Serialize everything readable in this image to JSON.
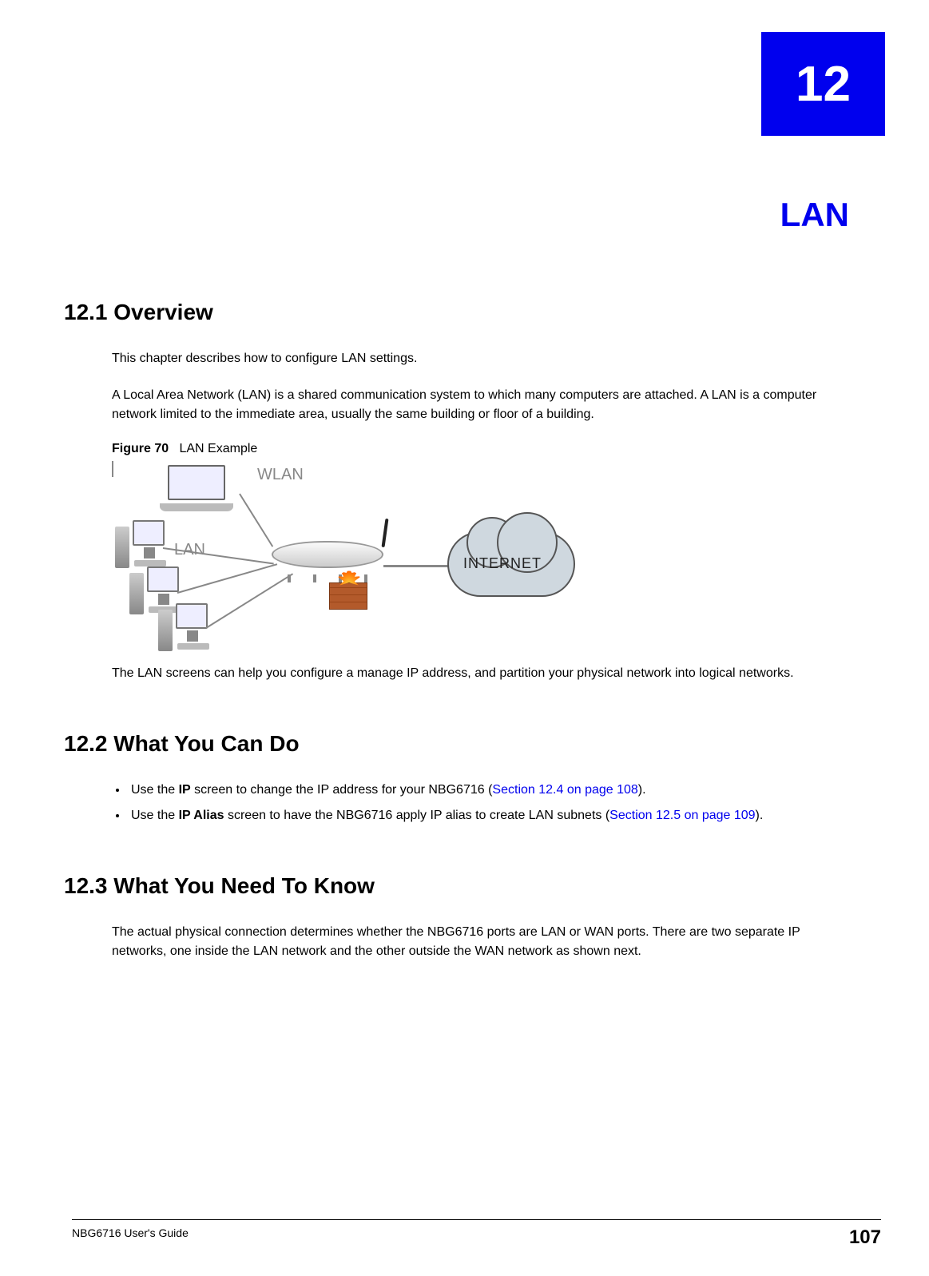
{
  "chapter": {
    "number": "12",
    "title": "LAN"
  },
  "sections": {
    "s1": {
      "heading": "12.1  Overview",
      "p1": "This chapter describes how to configure LAN settings.",
      "p2": "A Local Area Network (LAN) is a shared communication system to which many computers are attached. A LAN is a computer network limited to the immediate area, usually the same building or floor of a building.",
      "figure_label": "Figure 70",
      "figure_caption": "LAN Example",
      "diagram": {
        "wlan_label": "WLAN",
        "lan_label": "LAN",
        "cloud_label": "INTERNET"
      },
      "p3": "The LAN screens can help you configure a manage IP address, and partition your physical network into logical networks."
    },
    "s2": {
      "heading": "12.2  What You Can Do",
      "bullets": [
        {
          "pre": "Use the ",
          "bold": "IP",
          "mid": " screen to change the IP address for your NBG6716 (",
          "link": "Section 12.4 on page 108",
          "post": ")."
        },
        {
          "pre": "Use the ",
          "bold": "IP Alias",
          "mid": " screen to have the NBG6716 apply IP alias to create LAN subnets (",
          "link": "Section 12.5 on page 109",
          "post": ")."
        }
      ]
    },
    "s3": {
      "heading": "12.3  What You Need To Know",
      "p1": "The actual physical connection determines whether the NBG6716 ports are LAN or WAN ports. There are two separate IP networks, one inside the LAN network and the other outside the WAN network as shown next."
    }
  },
  "footer": {
    "guide": "NBG6716 User's Guide",
    "page": "107"
  }
}
